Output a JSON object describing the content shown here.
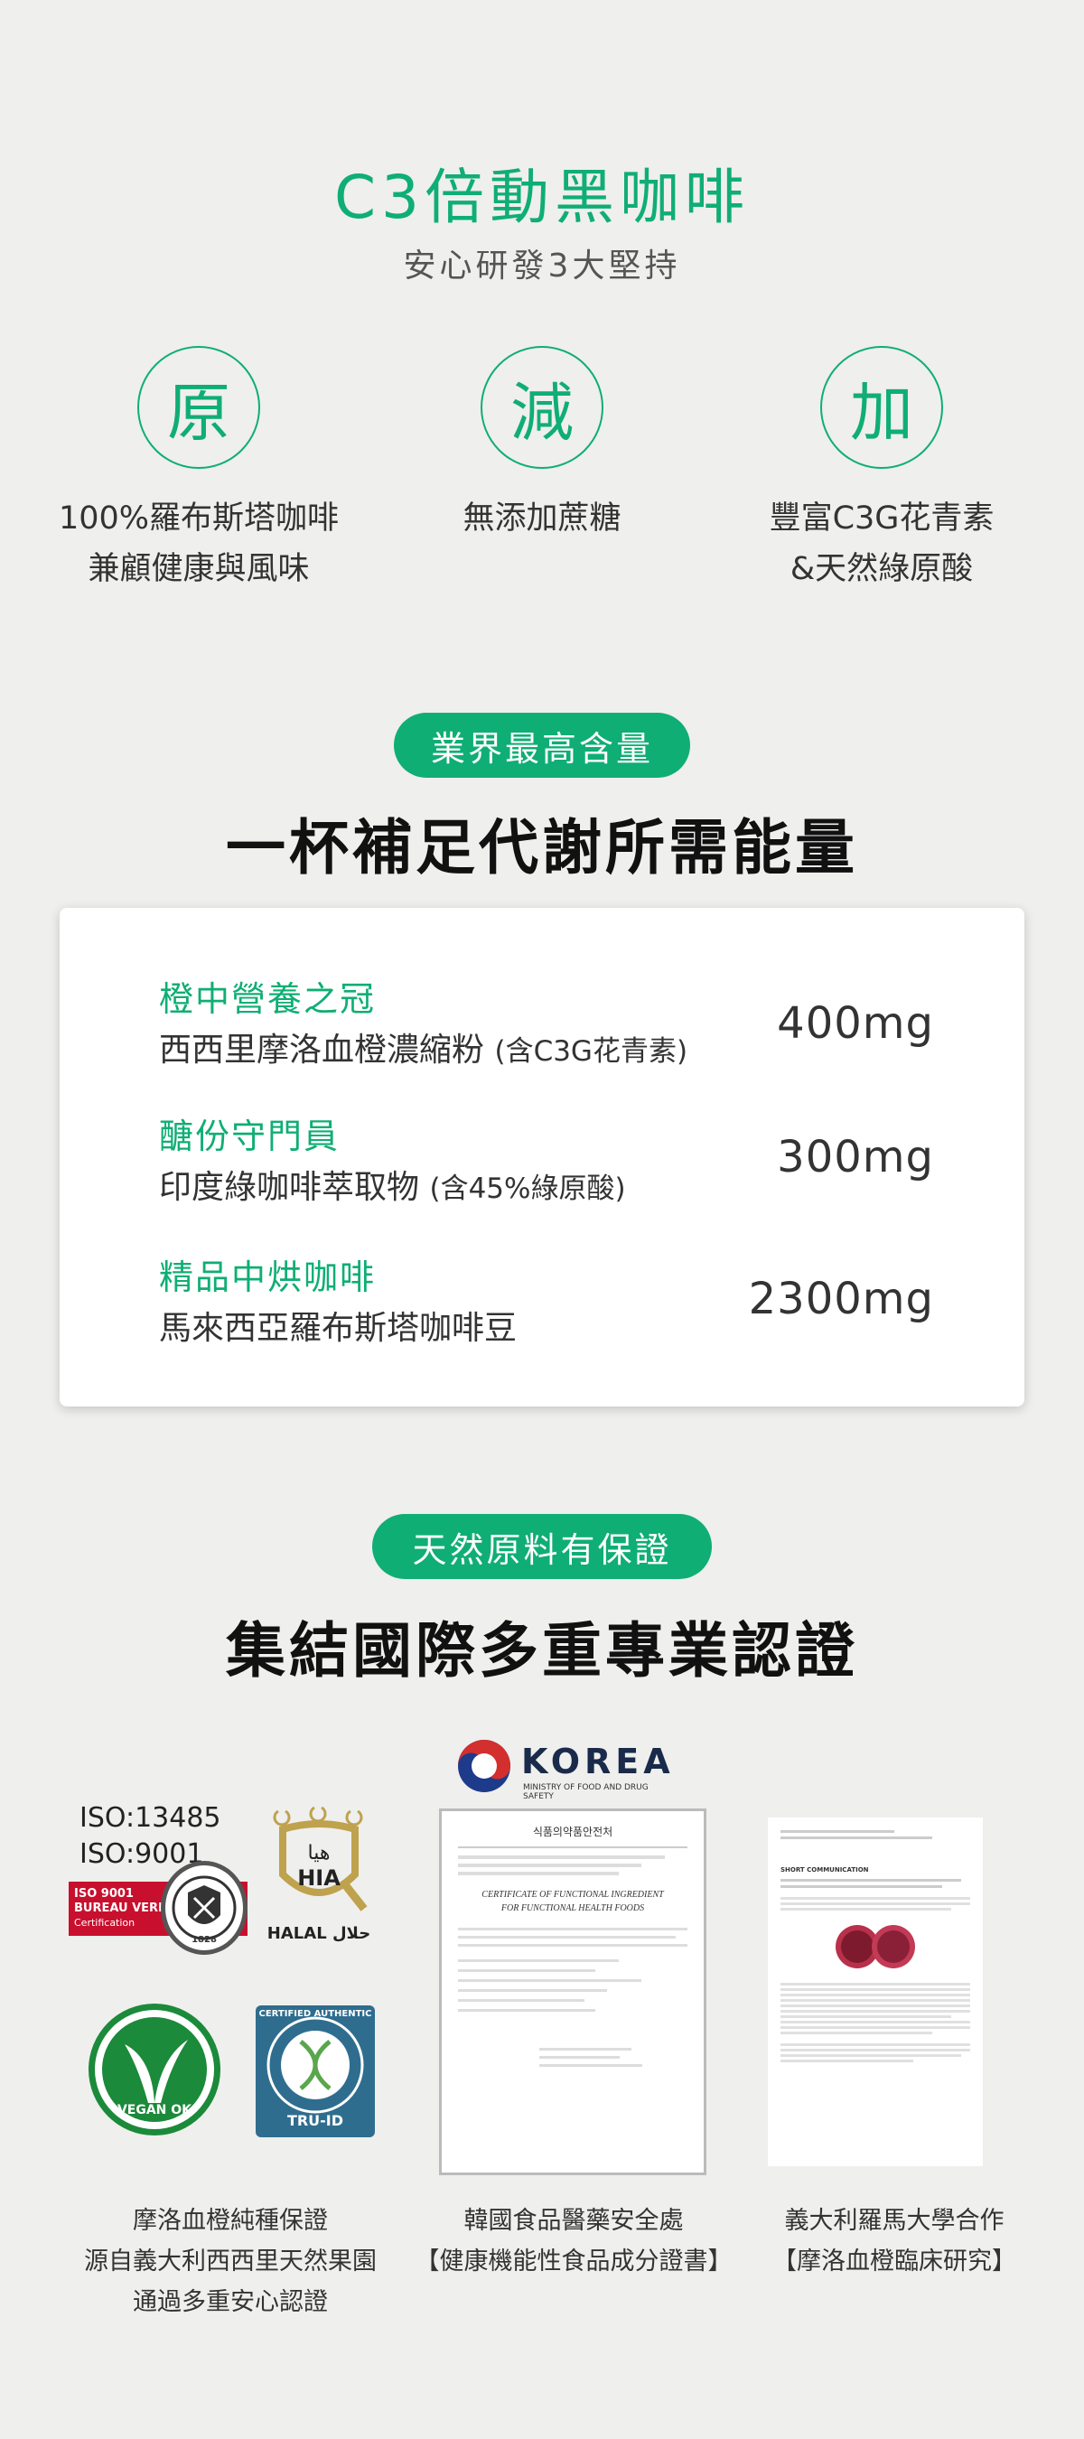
{
  "header": {
    "title": "C3倍動黑咖啡",
    "subtitle": "安心研發3大堅持"
  },
  "features": [
    {
      "char": "原",
      "line1": "100%羅布斯塔咖啡",
      "line2": "兼顧健康與風味"
    },
    {
      "char": "減",
      "line1": "無添加蔗糖",
      "line2": ""
    },
    {
      "char": "加",
      "line1": "豐富C3G花青素",
      "line2": "&天然綠原酸"
    }
  ],
  "content_section": {
    "badge": "業界最高含量",
    "heading": "一杯補足代謝所需能量",
    "items": [
      {
        "title": "橙中營養之冠",
        "desc": "西西里摩洛血橙濃縮粉",
        "note": "(含C3G花青素)",
        "amount": "400mg"
      },
      {
        "title": "醣份守門員",
        "desc": "印度綠咖啡萃取物",
        "note": "(含45%綠原酸)",
        "amount": "300mg"
      },
      {
        "title": "精品中烘咖啡",
        "desc": "馬來西亞羅布斯塔咖啡豆",
        "note": "",
        "amount": "2300mg"
      }
    ]
  },
  "cert_section": {
    "badge": "天然原料有保證",
    "heading": "集結國際多重專業認證",
    "iso_lines": [
      "ISO:13485",
      "ISO:9001"
    ],
    "bureau_veritas": {
      "iso": "ISO 9001",
      "name": "BUREAU VERITAS",
      "sub": "Certification",
      "seal_year": "1828"
    },
    "hia": {
      "arabic": "هيا",
      "abbr": "HIA",
      "halal": "HALAL حلال"
    },
    "vegan_ok": "VEGAN OK",
    "tru_id": {
      "ring": "CERTIFIED AUTHENTIC",
      "label": "TRU-ID"
    },
    "korea": {
      "name": "KOREA",
      "ministry": "MINISTRY OF FOOD AND DRUG SAFETY"
    },
    "certificate": {
      "header": "식품의약품안전처",
      "title_line1": "CERTIFICATE OF FUNCTIONAL INGREDIENT",
      "title_line2": "FOR FUNCTIONAL HEALTH FOODS"
    },
    "paper": {
      "heading": "SHORT COMMUNICATION"
    },
    "captions": [
      {
        "lines": [
          "摩洛血橙純種保證",
          "源自義大利西西里天然果園",
          "通過多重安心認證"
        ]
      },
      {
        "lines": [
          "韓國食品醫藥安全處",
          "【健康機能性食品成分證書】"
        ]
      },
      {
        "lines": [
          "義大利羅馬大學合作",
          "【摩洛血橙臨床研究】"
        ]
      }
    ]
  },
  "colors": {
    "accent": "#0fae74",
    "background": "#efefed"
  }
}
